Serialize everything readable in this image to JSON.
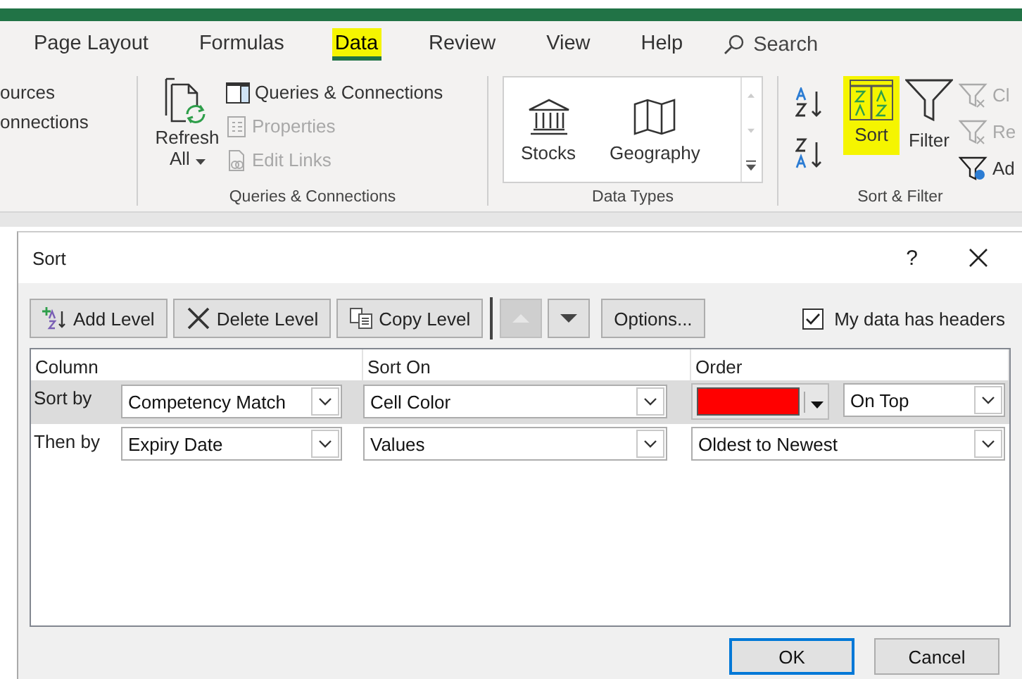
{
  "ribbon": {
    "tabs": [
      {
        "label": "Page Layout",
        "selected": false,
        "highlighted": false
      },
      {
        "label": "Formulas",
        "selected": false,
        "highlighted": false
      },
      {
        "label": "Data",
        "selected": true,
        "highlighted": true
      },
      {
        "label": "Review",
        "selected": false,
        "highlighted": false
      },
      {
        "label": "View",
        "selected": false,
        "highlighted": false
      },
      {
        "label": "Help",
        "selected": false,
        "highlighted": false
      }
    ],
    "search_label": "Search",
    "cut_group": {
      "items": [
        "ources",
        "onnections"
      ]
    },
    "queries_group": {
      "label": "Queries & Connections",
      "refresh": "Refresh",
      "refresh_sub": "All",
      "items": [
        {
          "label": "Queries & Connections",
          "disabled": false
        },
        {
          "label": "Properties",
          "disabled": true
        },
        {
          "label": "Edit Links",
          "disabled": true
        }
      ]
    },
    "types_group": {
      "label": "Data Types",
      "items": [
        "Stocks",
        "Geography"
      ]
    },
    "sort_group": {
      "label": "Sort & Filter",
      "sort": {
        "label": "Sort",
        "highlighted": true
      },
      "filter": "Filter",
      "items": [
        {
          "label": "Cl",
          "disabled": true
        },
        {
          "label": "Re",
          "disabled": true
        },
        {
          "label": "Ad",
          "disabled": false
        }
      ]
    }
  },
  "dialog": {
    "title": "Sort",
    "help": "?",
    "toolbar": [
      {
        "kind": "add",
        "label": "Add Level",
        "disabled": false
      },
      {
        "kind": "delete",
        "label": "Delete Level",
        "disabled": false
      },
      {
        "kind": "copy",
        "label": "Copy Level",
        "disabled": false
      },
      {
        "kind": "up",
        "disabled": true
      },
      {
        "kind": "down",
        "disabled": false
      },
      {
        "kind": "options",
        "label": "Options...",
        "disabled": false
      }
    ],
    "headers_checkbox": {
      "label": "My data has headers",
      "checked": true
    },
    "columns": [
      "Column",
      "Sort On",
      "Order"
    ],
    "levels": [
      {
        "label": "Sort by",
        "selected": true,
        "column": "Competency Match",
        "sort_on": "Cell Color",
        "color": "#ff0000",
        "position": "On Top"
      },
      {
        "label": "Then by",
        "selected": false,
        "column": "Expiry Date",
        "sort_on": "Values",
        "order": "Oldest to Newest"
      }
    ],
    "buttons": [
      {
        "label": "OK",
        "default": true
      },
      {
        "label": "Cancel",
        "default": false
      }
    ]
  }
}
